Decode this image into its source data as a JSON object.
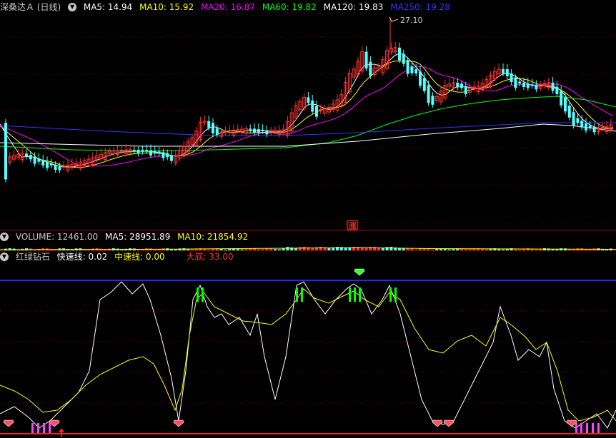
{
  "header": {
    "title": "深桑达Ａ (日线)",
    "ma": [
      {
        "label": "MA5: 14.94",
        "color": "#ffffff"
      },
      {
        "label": "MA10: 15.92",
        "color": "#ffff00"
      },
      {
        "label": "MA20: 16.87",
        "color": "#ff00ff"
      },
      {
        "label": "MA60: 19.82",
        "color": "#00ff00"
      },
      {
        "label": "MA120: 19.83",
        "color": "#ffffff"
      },
      {
        "label": "MA250: 19.28",
        "color": "#3333ff"
      }
    ],
    "peak_label": "27.10",
    "up_marker": "涨"
  },
  "volume": {
    "label": "VOLUME: 12461.00",
    "ma5": "MA5: 28951.89",
    "ma10": "MA10: 21854.92"
  },
  "indicator": {
    "name": "红绿钻石",
    "fast": "快速线: 0.02",
    "mid": "中速线: 0.00",
    "bottom": "大底: 33.00"
  },
  "colors": {
    "up": "#ff3232",
    "down": "#54ffff",
    "grid": "#800000",
    "separator": "#b00000"
  }
}
